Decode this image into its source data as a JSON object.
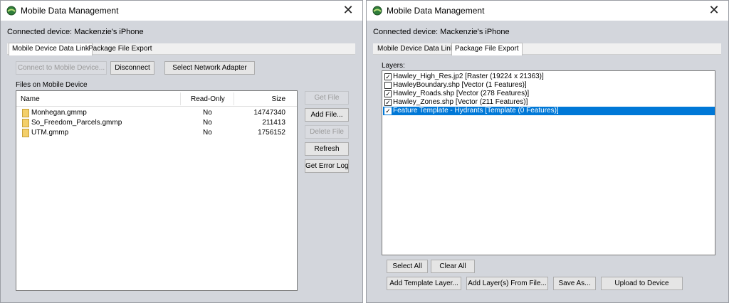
{
  "windows": [
    {
      "title": "Mobile Data Management",
      "connected": "Connected device: Mackenzie's iPhone",
      "tabs": [
        "Mobile Device Data Link",
        "Package File Export"
      ],
      "active_tab": 0,
      "buttons": {
        "connect": "Connect to Mobile Device...",
        "disconnect": "Disconnect",
        "select_adapter": "Select Network Adapter",
        "get_file": "Get File",
        "add_file": "Add File...",
        "delete_file": "Delete File",
        "refresh": "Refresh",
        "get_error_log": "Get Error Log"
      },
      "files_label": "Files on Mobile Device",
      "columns": [
        "Name",
        "Read-Only",
        "Size"
      ],
      "files": [
        {
          "name": "Monhegan.gmmp",
          "readonly": "No",
          "size": "14747340"
        },
        {
          "name": "So_Freedom_Parcels.gmmp",
          "readonly": "No",
          "size": "211413"
        },
        {
          "name": "UTM.gmmp",
          "readonly": "No",
          "size": "1756152"
        }
      ]
    },
    {
      "title": "Mobile Data Management",
      "connected": "Connected device: Mackenzie's iPhone",
      "tabs": [
        "Mobile Device Data Link",
        "Package File Export"
      ],
      "active_tab": 1,
      "layers_label": "Layers:",
      "layers": [
        {
          "text": "Hawley_High_Res.jp2 [Raster (19224 x 21363)]",
          "checked": true,
          "selected": false
        },
        {
          "text": "HawleyBoundary.shp [Vector (1 Features)]",
          "checked": false,
          "selected": false
        },
        {
          "text": "Hawley_Roads.shp [Vector (278 Features)]",
          "checked": true,
          "selected": false
        },
        {
          "text": "Hawley_Zones.shp [Vector (211 Features)]",
          "checked": true,
          "selected": false
        },
        {
          "text": "Feature Template - Hydrants [Template (0 Features)]",
          "checked": true,
          "selected": true
        }
      ],
      "buttons": {
        "select_all": "Select All",
        "clear_all": "Clear All",
        "add_template_layer": "Add Template Layer...",
        "add_layers_from_file": "Add Layer(s) From File...",
        "save_as": "Save As...",
        "upload": "Upload to Device"
      }
    }
  ],
  "colors": {
    "window_bg": "#d3d6dc",
    "selection": "#0078d7",
    "folder": "#f3cf6a"
  },
  "icons": {
    "app": "globe-icon",
    "close": "close-icon",
    "file": "folder-icon",
    "check": "checkmark-icon"
  },
  "glyphs": {
    "close": "✕",
    "check": "✓"
  }
}
